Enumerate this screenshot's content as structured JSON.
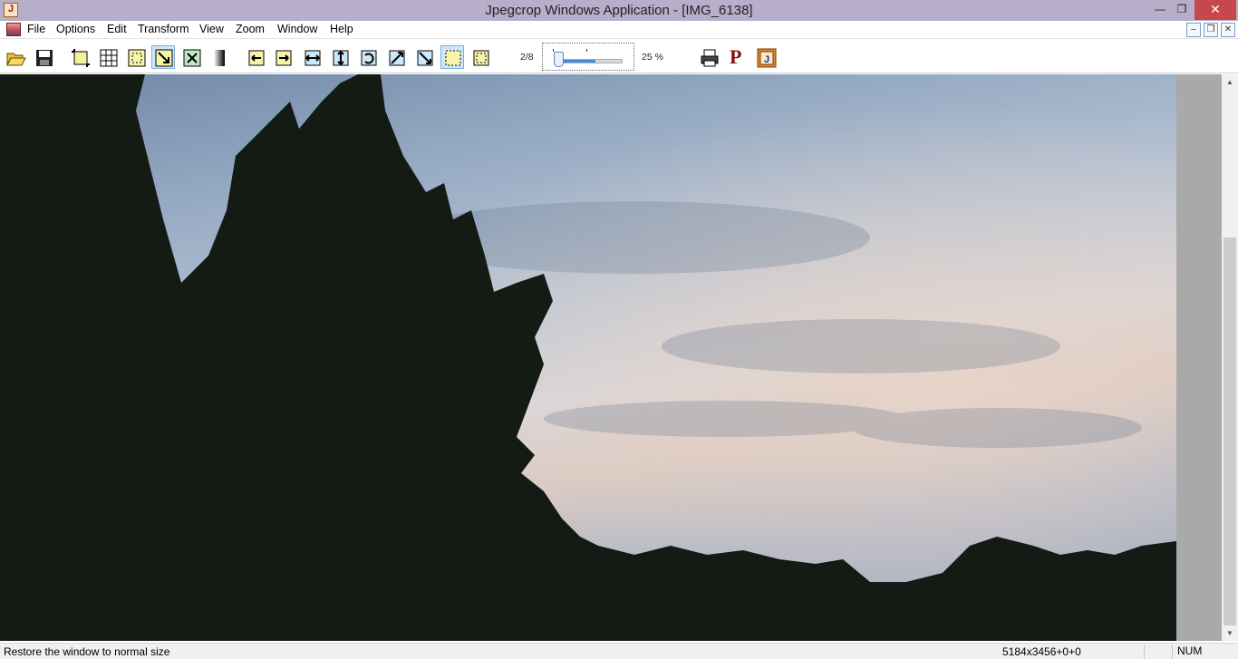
{
  "window": {
    "title": "Jpegcrop Windows Application - [IMG_6138]",
    "controls": {
      "minimize": "—",
      "maximize": "❐",
      "close": "✕"
    }
  },
  "menu": {
    "items": [
      "File",
      "Options",
      "Edit",
      "Transform",
      "View",
      "Zoom",
      "Window",
      "Help"
    ],
    "mdi_controls": {
      "minimize": "–",
      "restore": "❐",
      "close": "✕"
    }
  },
  "toolbar": {
    "scale_fraction": "2/8",
    "zoom_percent": "25 %",
    "slider_value_fraction": 0.25,
    "print_label": "P"
  },
  "image": {
    "name": "IMG_6138",
    "description_icons": [
      "tree-silhouette",
      "sky"
    ]
  },
  "status": {
    "message": "Restore the window to normal size",
    "image_info": "5184x3456+0+0",
    "num_lock": "NUM"
  },
  "colors": {
    "titlebar": "#b7aec9",
    "close_button": "#c7474a",
    "active_tool": "#cde6fb"
  }
}
